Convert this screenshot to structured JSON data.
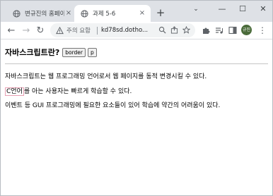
{
  "tabs": [
    {
      "title": "변규진의 홈페이지",
      "active": false,
      "close": "×"
    },
    {
      "title": "과제 5-6",
      "active": true,
      "close": "×"
    }
  ],
  "new_tab_label": "+",
  "window_controls": {
    "minimize": "—",
    "maximize": "☐",
    "close": "✕",
    "tab_search": "⌄"
  },
  "toolbar": {
    "back": "←",
    "forward": "→",
    "reload": "↻",
    "security_label": "주의 요함",
    "url": "kd78sd.dotho...",
    "profile_initials": "규진",
    "menu": "⋮"
  },
  "page": {
    "heading": "자바스크립트란?",
    "buttons": [
      "border",
      "p"
    ],
    "paragraph1": "자바스크립트는 웹 프로그래밍 언어로서 웹 페이지를 동적 변경시킬 수 있다.",
    "paragraph2_boxed": "C언어",
    "paragraph2_rest": "를 아는 사용자는 빠르게 학습할 수 있다.",
    "paragraph3": "이벤트 등 GUI 프로그래밍에 필요한 요소들이 있어 학습에 약간의 어려움이 있다."
  },
  "colors": {
    "tabstrip": "#dee1e6",
    "omnibox": "#f1f3f4",
    "avatar": "#4a6b3a",
    "boxed_border": "#e8a0b4"
  }
}
